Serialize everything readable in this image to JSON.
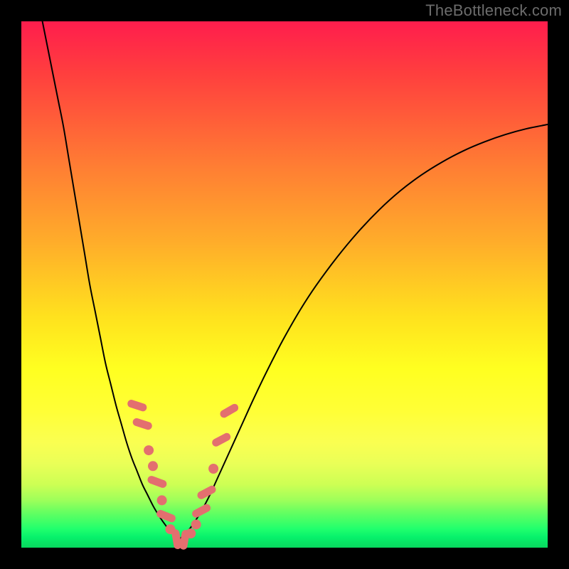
{
  "watermark": "TheBottleneck.com",
  "colors": {
    "dot": "#e36f6f",
    "curve": "#000000",
    "background_black": "#000000"
  },
  "chart_data": {
    "type": "line",
    "title": "",
    "xlabel": "",
    "ylabel": "",
    "xlim": [
      0,
      100
    ],
    "ylim": [
      0,
      100
    ],
    "curves": [
      {
        "name": "left-branch",
        "x": [
          4,
          5,
          6,
          7,
          8,
          9,
          10,
          11,
          12,
          13,
          14,
          15,
          16,
          17,
          18,
          19,
          20,
          21,
          22,
          23,
          24,
          25,
          26,
          27,
          28,
          29,
          30
        ],
        "y": [
          100,
          95,
          90,
          85,
          80,
          74,
          68,
          62,
          56,
          50,
          45,
          40,
          35,
          31,
          27,
          23.5,
          20,
          17,
          14.5,
          12,
          10,
          8,
          6.3,
          4.8,
          3.5,
          2.4,
          1.6
        ]
      },
      {
        "name": "right-branch",
        "x": [
          30,
          31,
          32,
          33,
          34,
          35,
          36,
          37,
          38,
          40,
          42,
          44,
          46,
          48,
          50,
          53,
          56,
          60,
          64,
          68,
          72,
          76,
          80,
          84,
          88,
          92,
          96,
          100
        ],
        "y": [
          1.6,
          2.5,
          3.6,
          5,
          6.6,
          8.4,
          10.4,
          12.6,
          14.8,
          19.2,
          23.6,
          28.0,
          32.2,
          36.2,
          40.0,
          45.2,
          49.8,
          55.2,
          60.0,
          64.2,
          67.8,
          70.8,
          73.3,
          75.4,
          77.1,
          78.5,
          79.6,
          80.4
        ]
      }
    ],
    "markers": {
      "name": "scatter-overlay",
      "shape_note": "pale pink rounded dots / short capsules overlaid along the trough region of the curve",
      "points": [
        {
          "x": 22,
          "y": 27,
          "kind": "pill",
          "angle": -72
        },
        {
          "x": 23,
          "y": 23.5,
          "kind": "pill",
          "angle": -72
        },
        {
          "x": 24.2,
          "y": 18.5,
          "kind": "dot"
        },
        {
          "x": 25,
          "y": 15.5,
          "kind": "dot"
        },
        {
          "x": 25.8,
          "y": 12.5,
          "kind": "pill",
          "angle": -70
        },
        {
          "x": 26.7,
          "y": 9,
          "kind": "dot"
        },
        {
          "x": 27.5,
          "y": 6,
          "kind": "pill",
          "angle": -68
        },
        {
          "x": 28.3,
          "y": 3.5,
          "kind": "dot"
        },
        {
          "x": 29.5,
          "y": 1.6,
          "kind": "pill",
          "angle": -10
        },
        {
          "x": 31,
          "y": 1.5,
          "kind": "pill",
          "angle": 10
        },
        {
          "x": 32.2,
          "y": 2.7,
          "kind": "dot"
        },
        {
          "x": 33.2,
          "y": 4.4,
          "kind": "dot"
        },
        {
          "x": 34.2,
          "y": 7,
          "kind": "pill",
          "angle": 62
        },
        {
          "x": 35.2,
          "y": 10.5,
          "kind": "pill",
          "angle": 62
        },
        {
          "x": 36.5,
          "y": 15,
          "kind": "dot"
        },
        {
          "x": 38,
          "y": 20.5,
          "kind": "pill",
          "angle": 62
        },
        {
          "x": 39.5,
          "y": 26,
          "kind": "pill",
          "angle": 60
        }
      ]
    }
  }
}
